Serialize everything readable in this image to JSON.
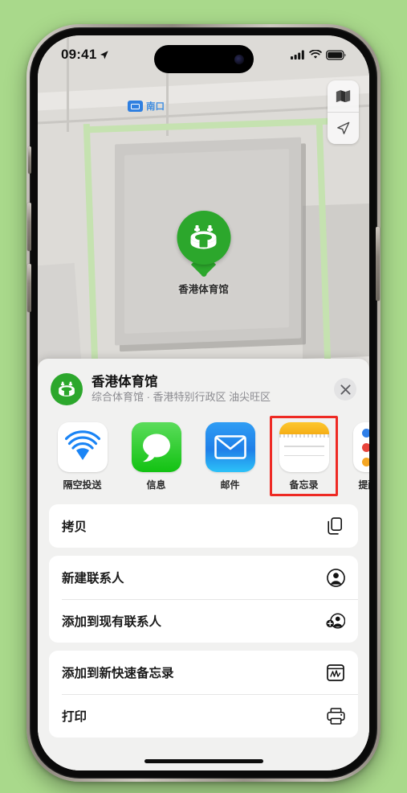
{
  "background_color": "#a9d98b",
  "status_bar": {
    "time": "09:41",
    "location_arrow": "location-arrow-icon",
    "cellular": "cellular-bars-icon",
    "wifi": "wifi-icon",
    "battery": "battery-icon"
  },
  "map": {
    "transit_label": "南口",
    "pin_label": "香港体育馆",
    "controls": [
      {
        "name": "map-layers-button",
        "icon": "folded-map-icon"
      },
      {
        "name": "current-location-button",
        "icon": "location-arrow-icon"
      }
    ]
  },
  "sheet": {
    "title": "香港体育馆",
    "subtitle": "综合体育馆 · 香港特别行政区 油尖旺区",
    "avatar_icon": "stadium-icon",
    "close_label": "✕",
    "apps": [
      {
        "label": "隔空投送",
        "icon": "airdrop-icon",
        "selected": false
      },
      {
        "label": "信息",
        "icon": "messages-icon",
        "selected": false
      },
      {
        "label": "邮件",
        "icon": "mail-icon",
        "selected": false
      },
      {
        "label": "备忘录",
        "icon": "notes-icon",
        "selected": true
      },
      {
        "label": "提醒事项",
        "icon": "reminders-icon",
        "selected": false
      }
    ],
    "highlight_color": "#ee2a24",
    "groups": [
      {
        "rows": [
          {
            "label": "拷贝",
            "icon": "copy-icon"
          }
        ]
      },
      {
        "rows": [
          {
            "label": "新建联系人",
            "icon": "person-circle-icon"
          },
          {
            "label": "添加到现有联系人",
            "icon": "person-add-icon"
          }
        ]
      },
      {
        "rows": [
          {
            "label": "添加到新快速备忘录",
            "icon": "quick-note-icon"
          },
          {
            "label": "打印",
            "icon": "printer-icon"
          }
        ]
      }
    ]
  }
}
